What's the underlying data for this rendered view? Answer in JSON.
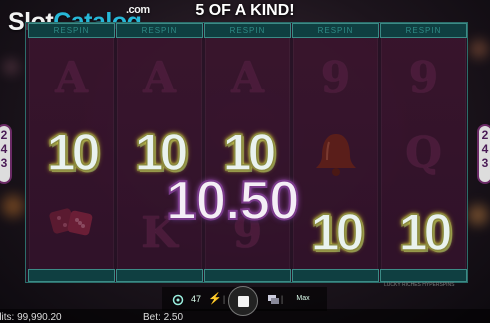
{
  "watermark": {
    "part1": "Slot",
    "part2": "Catalog",
    "suffix": ".com"
  },
  "banner": "5 OF A KIND!",
  "respin_label": "RESPIN",
  "reels": [
    [
      "A",
      "10",
      "dice"
    ],
    [
      "A",
      "10",
      "K"
    ],
    [
      "A",
      "10",
      "9"
    ],
    [
      "9",
      "bell",
      "10"
    ],
    [
      "9",
      "Q",
      "10"
    ]
  ],
  "side_indicators": {
    "left": [
      "2",
      "4",
      "3"
    ],
    "right": [
      "2",
      "4",
      "3"
    ]
  },
  "win_amount": "10.50",
  "small_print": "LUCKY RICHES HYPERSPINS",
  "controls": {
    "autoplay_count": "47",
    "max_label": "Max"
  },
  "status": {
    "credits": "dits: 99,990.20",
    "bet": "Bet: 2.50"
  },
  "colors": {
    "frame_accent": "#3b8b86",
    "win_glow": "#b05ed0",
    "ten_glow": "#e8e04a"
  }
}
